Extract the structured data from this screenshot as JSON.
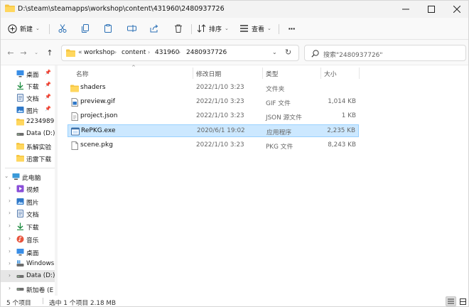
{
  "window": {
    "title": "D:\\steam\\steamapps\\workshop\\content\\431960\\2480937726"
  },
  "commandbar": {
    "new_label": "新建",
    "sort_label": "排序",
    "view_label": "查看",
    "more_label": "···"
  },
  "address": {
    "overflow": "«",
    "crumbs": [
      "workshop",
      "content",
      "431960",
      "2480937726"
    ]
  },
  "search": {
    "placeholder": "搜索\"2480937726\""
  },
  "nav": {
    "quick": [
      {
        "label": "桌面",
        "icon": "desktop-icon",
        "pinned": true
      },
      {
        "label": "下载",
        "icon": "download-icon",
        "pinned": true
      },
      {
        "label": "文档",
        "icon": "documents-icon",
        "pinned": true
      },
      {
        "label": "图片",
        "icon": "pictures-icon",
        "pinned": true
      },
      {
        "label": "2234989",
        "icon": "folder-icon",
        "pinned": false
      },
      {
        "label": "Data (D:)",
        "icon": "drive-icon",
        "pinned": false
      },
      {
        "label": "系解实验",
        "icon": "folder-icon",
        "pinned": false
      },
      {
        "label": "迅雷下载",
        "icon": "folder-icon",
        "pinned": false
      }
    ],
    "thispc_label": "此电脑",
    "thispc_children": [
      {
        "label": "视频",
        "icon": "videos-icon"
      },
      {
        "label": "图片",
        "icon": "pictures-icon"
      },
      {
        "label": "文档",
        "icon": "documents-icon"
      },
      {
        "label": "下载",
        "icon": "download-icon"
      },
      {
        "label": "音乐",
        "icon": "music-icon"
      },
      {
        "label": "桌面",
        "icon": "desktop-icon"
      },
      {
        "label": "Windows",
        "icon": "windows-drive-icon"
      },
      {
        "label": "Data (D:)",
        "icon": "drive-icon"
      },
      {
        "label": "新加卷 (E",
        "icon": "drive-icon"
      }
    ]
  },
  "columns": {
    "name": "名称",
    "date": "修改日期",
    "type": "类型",
    "size": "大小"
  },
  "files": [
    {
      "name": "shaders",
      "date": "2022/1/10 3:23",
      "type": "文件夹",
      "size": "",
      "icon": "folder-icon",
      "selected": false
    },
    {
      "name": "preview.gif",
      "date": "2022/1/10 3:23",
      "type": "GIF 文件",
      "size": "1,014 KB",
      "icon": "gif-file-icon",
      "selected": false
    },
    {
      "name": "project.json",
      "date": "2022/1/10 3:23",
      "type": "JSON 源文件",
      "size": "1 KB",
      "icon": "json-file-icon",
      "selected": false
    },
    {
      "name": "RePKG.exe",
      "date": "2020/6/1 19:02",
      "type": "应用程序",
      "size": "2,235 KB",
      "icon": "exe-file-icon",
      "selected": true
    },
    {
      "name": "scene.pkg",
      "date": "2022/1/10 3:23",
      "type": "PKG 文件",
      "size": "8,243 KB",
      "icon": "file-icon",
      "selected": false
    }
  ],
  "status": {
    "count": "5 个项目",
    "selection": "选中 1 个项目  2.18 MB"
  },
  "colors": {
    "accent": "#0067c0",
    "selection_fill": "#cce8ff",
    "selection_border": "#99d1ff",
    "folder": "#f5c542"
  }
}
